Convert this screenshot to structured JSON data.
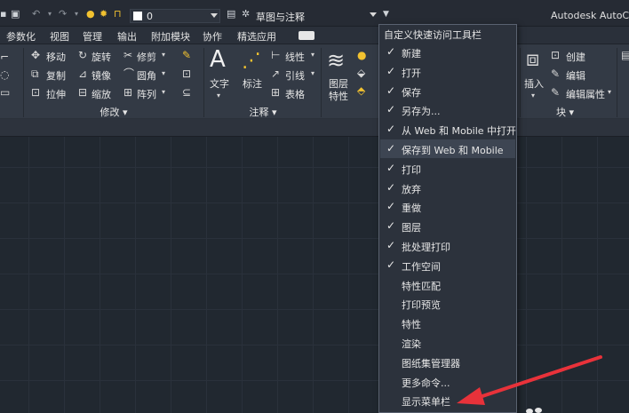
{
  "quick_access": {
    "layer_value": "0",
    "workspace": "草图与注释",
    "app_title": "Autodesk AutoCA"
  },
  "tabs": [
    "参数化",
    "视图",
    "管理",
    "输出",
    "附加模块",
    "协作",
    "精选应用"
  ],
  "ribbon": {
    "modify": {
      "move": "移动",
      "rotate": "旋转",
      "trim": "修剪",
      "copy": "复制",
      "mirror": "镜像",
      "fillet": "圆角",
      "stretch": "拉伸",
      "scale": "缩放",
      "array": "阵列",
      "title": "修改"
    },
    "annotation": {
      "text": "文字",
      "dimension": "标注",
      "linetype": "线性",
      "leader": "引线",
      "table": "表格",
      "title": "注释"
    },
    "layers": {
      "layer_props_1": "图层",
      "layer_props_2": "特性"
    },
    "block": {
      "insert": "插入",
      "create": "创建",
      "edit": "编辑",
      "edit_attributes": "编辑属性",
      "title": "块"
    }
  },
  "menu": {
    "header": "自定义快速访问工具栏",
    "items": [
      {
        "label": "新建",
        "checked": true
      },
      {
        "label": "打开",
        "checked": true
      },
      {
        "label": "保存",
        "checked": true
      },
      {
        "label": "另存为...",
        "checked": true
      },
      {
        "label": "从 Web 和 Mobile 中打开",
        "checked": true
      },
      {
        "label": "保存到 Web 和 Mobile",
        "checked": true,
        "highlighted": true
      },
      {
        "label": "打印",
        "checked": true
      },
      {
        "label": "放弃",
        "checked": true
      },
      {
        "label": "重做",
        "checked": true
      },
      {
        "label": "图层",
        "checked": true
      },
      {
        "label": "批处理打印",
        "checked": true
      },
      {
        "label": "工作空间",
        "checked": true
      },
      {
        "label": "特性匹配",
        "checked": false
      },
      {
        "label": "打印预览",
        "checked": false
      },
      {
        "label": "特性",
        "checked": false
      },
      {
        "label": "渲染",
        "checked": false
      },
      {
        "label": "图纸集管理器",
        "checked": false
      },
      {
        "label": "更多命令...",
        "checked": false
      },
      {
        "label": "显示菜单栏",
        "checked": false
      }
    ]
  },
  "colors": {
    "annotation_arrow": "#e8323a",
    "menu_highlight": "#3d4552",
    "bulb": "#f2c230"
  },
  "icons": {
    "check": "check-icon",
    "arrow": "red-arrow-annotation"
  }
}
